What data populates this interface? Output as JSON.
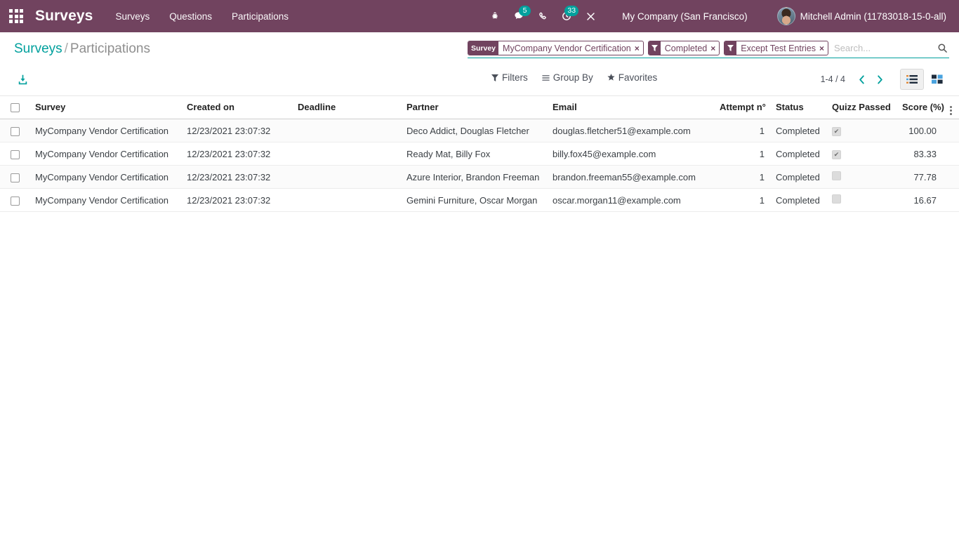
{
  "navbar": {
    "apps_icon": "apps-grid-icon",
    "brand": "Surveys",
    "menu": [
      {
        "label": "Surveys"
      },
      {
        "label": "Questions"
      },
      {
        "label": "Participations"
      }
    ],
    "systray": [
      {
        "name": "bug-icon",
        "badge": ""
      },
      {
        "name": "messages-icon",
        "badge": "5"
      },
      {
        "name": "phone-icon",
        "badge": ""
      },
      {
        "name": "activities-icon",
        "badge": "33"
      },
      {
        "name": "developer-tools-icon",
        "badge": ""
      }
    ],
    "company": "My Company (San Francisco)",
    "user": "Mitchell Admin (11783018-15-0-all)",
    "colors": {
      "header_bg": "#71435F",
      "badge_bg": "#00A09D",
      "accent": "#00A09D"
    }
  },
  "breadcrumb": {
    "root": "Surveys",
    "separator": "/",
    "current": "Participations"
  },
  "search": {
    "facets": [
      {
        "kind": "field",
        "label": "Survey",
        "value": "MyCompany Vendor Certification",
        "remove": "×"
      },
      {
        "kind": "filter",
        "label": "",
        "value": "Completed",
        "remove": "×"
      },
      {
        "kind": "filter",
        "label": "",
        "value": "Except Test Entries",
        "remove": "×"
      }
    ],
    "input_value": "",
    "placeholder": "Search...",
    "search_icon": "search-icon"
  },
  "toolbar": {
    "export_icon": "download-icon",
    "filters_label": "Filters",
    "groupby_label": "Group By",
    "favorites_label": "Favorites"
  },
  "pager": {
    "range": "1-4 / 4",
    "prev_icon": "chevron-left-icon",
    "next_icon": "chevron-right-icon"
  },
  "views": {
    "list_icon": "list-view-icon",
    "kanban_icon": "kanban-view-icon",
    "active": "list"
  },
  "table": {
    "columns": [
      "Survey",
      "Created on",
      "Deadline",
      "Partner",
      "Email",
      "Attempt n°",
      "Status",
      "Quizz Passed",
      "Score (%)"
    ],
    "options_icon": "optional-columns-icon",
    "rows": [
      {
        "survey": "MyCompany Vendor Certification",
        "created_on": "12/23/2021 23:07:32",
        "deadline": "",
        "partner": "Deco Addict, Douglas Fletcher",
        "email": "douglas.fletcher51@example.com",
        "attempt": "1",
        "status": "Completed",
        "quizz_passed": true,
        "score": "100.00"
      },
      {
        "survey": "MyCompany Vendor Certification",
        "created_on": "12/23/2021 23:07:32",
        "deadline": "",
        "partner": "Ready Mat, Billy Fox",
        "email": "billy.fox45@example.com",
        "attempt": "1",
        "status": "Completed",
        "quizz_passed": true,
        "score": "83.33"
      },
      {
        "survey": "MyCompany Vendor Certification",
        "created_on": "12/23/2021 23:07:32",
        "deadline": "",
        "partner": "Azure Interior, Brandon Freeman",
        "email": "brandon.freeman55@example.com",
        "attempt": "1",
        "status": "Completed",
        "quizz_passed": false,
        "score": "77.78"
      },
      {
        "survey": "MyCompany Vendor Certification",
        "created_on": "12/23/2021 23:07:32",
        "deadline": "",
        "partner": "Gemini Furniture, Oscar Morgan",
        "email": "oscar.morgan11@example.com",
        "attempt": "1",
        "status": "Completed",
        "quizz_passed": false,
        "score": "16.67"
      }
    ]
  }
}
